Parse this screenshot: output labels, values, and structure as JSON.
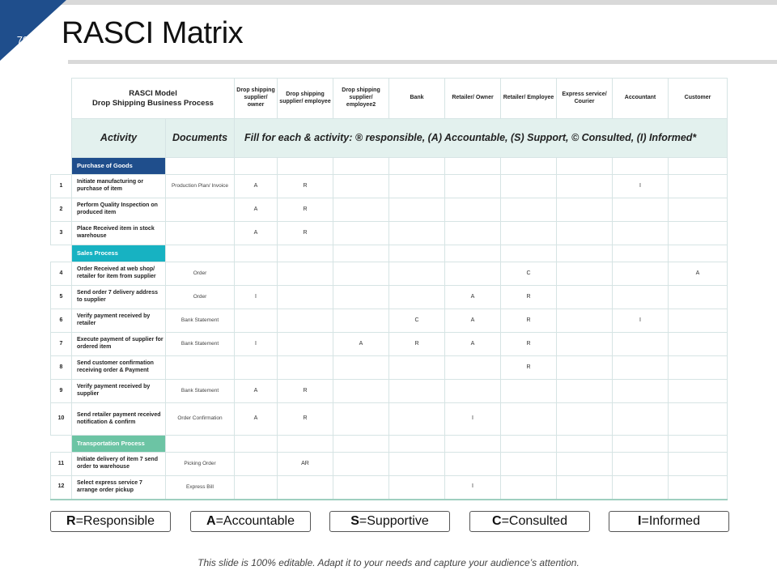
{
  "slide": {
    "number": "70",
    "title": "RASCI Matrix",
    "footer": "This slide is 100% editable. Adapt it to your needs and capture your audience’s attention."
  },
  "colors": {
    "accent_blue": "#1f4e8c",
    "section_teal": "#17b2c2",
    "section_green": "#6cc4a4",
    "activity_bg": "#e3f1ee"
  },
  "matrix": {
    "model_line1": "RASCI Model",
    "model_line2": "Drop Shipping Business Process",
    "roles": [
      "Drop shipping supplier/ owner",
      "Drop shipping supplier/ employee",
      "Drop shipping supplier/ employee2",
      "Bank",
      "Retailer/ Owner",
      "Retailer/ Employee",
      "Express service/ Courier",
      "Accountant",
      "Customer"
    ],
    "activity_header": "Activity",
    "documents_header": "Documents",
    "fill_instruction": "Fill for each & activity: ® responsible, (A) Accountable, (S) Support, © Consulted, (I) Informed*",
    "sections": [
      {
        "name": "Purchase of Goods",
        "rows": [
          {
            "num": "1",
            "activity": "Initiate manufacturing or purchase of item",
            "document": "Production Plan/ Invoice",
            "values": [
              "A",
              "R",
              "",
              "",
              "",
              "",
              "",
              "I",
              ""
            ]
          },
          {
            "num": "2",
            "activity": "Perform Quality Inspection on produced item",
            "document": "",
            "values": [
              "A",
              "R",
              "",
              "",
              "",
              "",
              "",
              "",
              ""
            ]
          },
          {
            "num": "3",
            "activity": "Place Received item in stock warehouse",
            "document": "",
            "values": [
              "A",
              "R",
              "",
              "",
              "",
              "",
              "",
              "",
              ""
            ]
          }
        ]
      },
      {
        "name": "Sales Process",
        "rows": [
          {
            "num": "4",
            "activity": "Order Received at web shop/ retailer for item from supplier",
            "document": "Order",
            "values": [
              "",
              "",
              "",
              "",
              "",
              "C",
              "",
              "",
              "A"
            ]
          },
          {
            "num": "5",
            "activity": "Send order 7 delivery address to supplier",
            "document": "Order",
            "values": [
              "I",
              "",
              "",
              "",
              "A",
              "R",
              "",
              "",
              ""
            ]
          },
          {
            "num": "6",
            "activity": "Verify payment received by retailer",
            "document": "Bank Statement",
            "values": [
              "",
              "",
              "",
              "C",
              "A",
              "R",
              "",
              "I",
              ""
            ]
          },
          {
            "num": "7",
            "activity": "Execute payment of supplier for ordered item",
            "document": "Bank Statement",
            "values": [
              "I",
              "",
              "A",
              "R",
              "A",
              "R",
              "",
              "",
              ""
            ]
          },
          {
            "num": "8",
            "activity": "Send customer confirmation receiving order & Payment",
            "document": "",
            "values": [
              "",
              "",
              "",
              "",
              "",
              "R",
              "",
              "",
              ""
            ]
          },
          {
            "num": "9",
            "activity": "Verify payment received by supplier",
            "document": "Bank Statement",
            "values": [
              "A",
              "R",
              "",
              "",
              "",
              "",
              "",
              "",
              ""
            ]
          },
          {
            "num": "10",
            "activity": "Send retailer payment received notification & confirm",
            "document": "Order Confirmation",
            "values": [
              "A",
              "R",
              "",
              "",
              "I",
              "",
              "",
              "",
              ""
            ]
          }
        ]
      },
      {
        "name": "Transportation Process",
        "rows": [
          {
            "num": "11",
            "activity": "Initiate delivery of item 7 send order to warehouse",
            "document": "Picking Order",
            "values": [
              "",
              "AR",
              "",
              "",
              "",
              "",
              "",
              "",
              ""
            ]
          },
          {
            "num": "12",
            "activity": "Select express service 7 arrange order pickup",
            "document": "Express Bill",
            "values": [
              "",
              "",
              "",
              "",
              "I",
              "",
              "",
              "",
              ""
            ]
          }
        ]
      }
    ]
  },
  "legend": [
    {
      "letter": "R",
      "text": "=Responsible"
    },
    {
      "letter": "A",
      "text": "=Accountable"
    },
    {
      "letter": "S",
      "text": "=Supportive"
    },
    {
      "letter": "C",
      "text": "=Consulted"
    },
    {
      "letter": "I",
      "text": "=Informed"
    }
  ]
}
